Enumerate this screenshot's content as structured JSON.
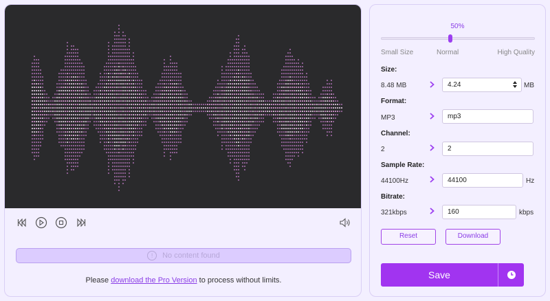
{
  "player": {
    "notice": "No content found",
    "notice_icon": "info-icon",
    "pro_prefix": "Please",
    "pro_link": "download the Pro Version",
    "pro_suffix": "to process without limits.",
    "accent": "#a134f0"
  },
  "slider": {
    "percent_label": "50%",
    "value_fraction": 0.45,
    "left_label": "Small Size",
    "mid_label": "Normal",
    "right_label": "High Quality"
  },
  "fields": {
    "size": {
      "title": "Size:",
      "original": "8.48 MB",
      "value": "4.24",
      "unit": "MB"
    },
    "format": {
      "title": "Format:",
      "original": "MP3",
      "value": "mp3"
    },
    "channel": {
      "title": "Channel:",
      "original": "2",
      "value": "2"
    },
    "sample_rate": {
      "title": "Sample Rate:",
      "original": "44100Hz",
      "value": "44100",
      "unit": "Hz"
    },
    "bitrate": {
      "title": "Bitrate:",
      "original": "321kbps",
      "value": "160",
      "unit": "kbps"
    }
  },
  "buttons": {
    "reset": "Reset",
    "download": "Download",
    "save": "Save"
  }
}
